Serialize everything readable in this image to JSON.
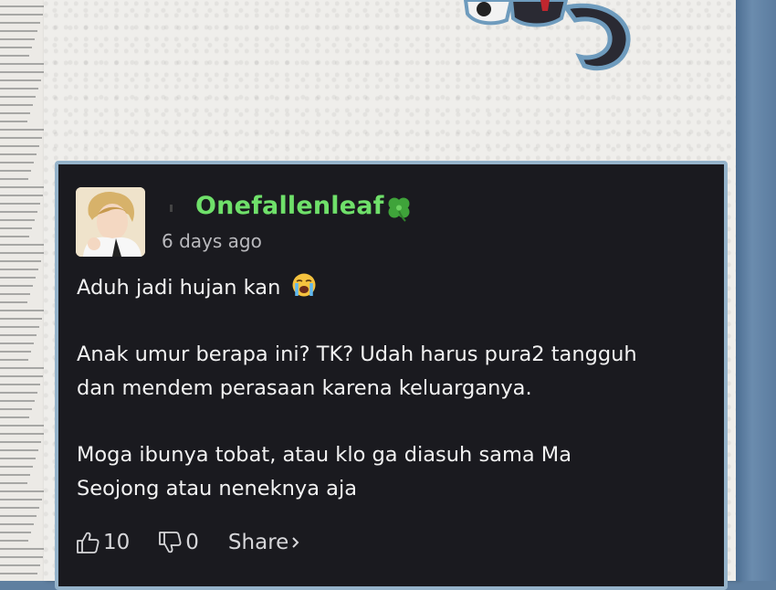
{
  "comment": {
    "username": "Onefallenleaf",
    "time": "6 days ago",
    "paragraph1": "Aduh jadi hujan kan",
    "paragraph2_line1": "Anak umur berapa ini? TK? Udah harus pura2 tangguh",
    "paragraph2_line2": "dan mendem perasaan karena keluarganya.",
    "paragraph3_line1": "Moga ibunya tobat, atau klo ga diasuh sama Ma",
    "paragraph3_line2": "Seojong atau neneknya aja"
  },
  "actions": {
    "like_count": "10",
    "dislike_count": "0",
    "share_label": "Share"
  },
  "icons": {
    "badge": "four-leaf-clover-icon",
    "emoji": "loudly-crying-face-icon",
    "like": "thumbs-up-icon",
    "dislike": "thumbs-down-icon",
    "share": "chevron-right-icon"
  },
  "colors": {
    "username": "#6fe06a",
    "card_bg": "#1a1a1f",
    "card_border": "#95b3ca"
  }
}
